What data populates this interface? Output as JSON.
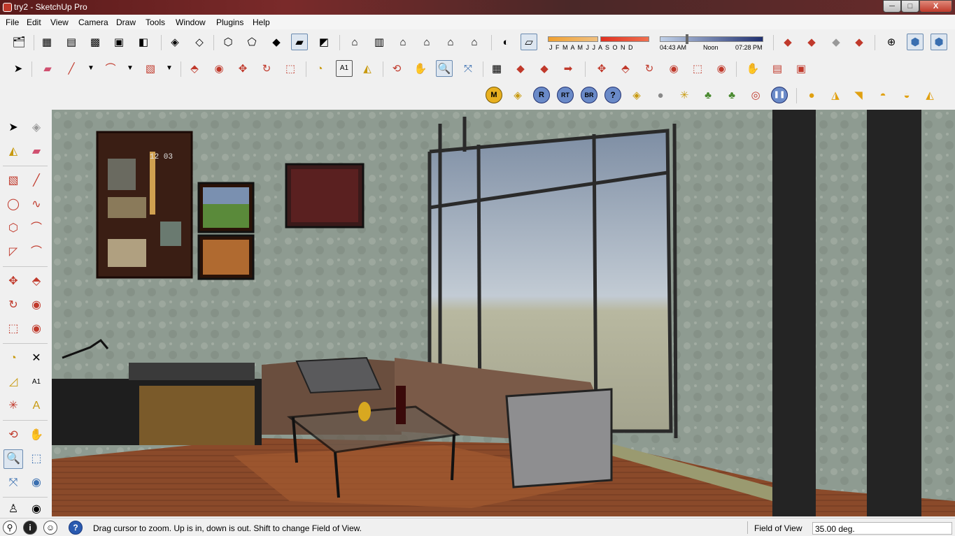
{
  "window": {
    "title": "try2 - SketchUp Pro",
    "min": "─",
    "max": "□",
    "close": "X"
  },
  "menubar": [
    "File",
    "Edit",
    "View",
    "Camera",
    "Draw",
    "Tools",
    "Window",
    "Plugins",
    "Help"
  ],
  "shadow": {
    "months": "J F M A M J J A S O N D",
    "time_start": "04:43 AM",
    "time_mid": "Noon",
    "time_end": "07:28 PM"
  },
  "plugin_icons": {
    "m": "M",
    "r": "R",
    "rt": "RT",
    "br": "BR",
    "help": "?"
  },
  "toolbar_icons": {
    "dimension_text": "A1"
  },
  "status": {
    "message": "Drag cursor to zoom.  Up is in, down is out. Shift to change Field of View.",
    "measurement_label": "Field of View",
    "measurement_value": "35.00 deg.",
    "info_icon": "i",
    "help_icon": "?"
  },
  "viewport": {
    "clock_text": "12 03"
  },
  "colors": {
    "wall": "#8d9a8e",
    "floor": "#8a4a2a",
    "window_glass": "#b9c4cc",
    "titlebar": "#6a2a2a",
    "active_tool": "#dde6f0"
  }
}
